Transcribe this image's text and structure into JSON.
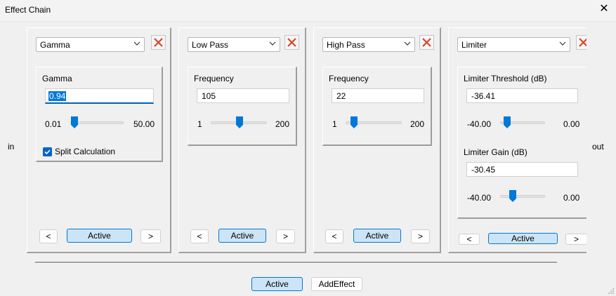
{
  "window": {
    "title": "Effect Chain"
  },
  "chain": {
    "in_label": "in",
    "out_label": "out"
  },
  "effects": [
    {
      "selected": "Gamma",
      "params": [
        {
          "label": "Gamma",
          "value": "0.94",
          "min": "0.01",
          "max": "50.00",
          "level": 0.02
        }
      ],
      "checkbox": {
        "label": "Split Calculation",
        "checked": true
      },
      "prev_label": "<",
      "active_label": "Active",
      "next_label": ">"
    },
    {
      "selected": "Low Pass",
      "params": [
        {
          "label": "Frequency",
          "value": "105",
          "min": "1",
          "max": "200",
          "level": 0.52
        }
      ],
      "prev_label": "<",
      "active_label": "Active",
      "next_label": ">"
    },
    {
      "selected": "High Pass",
      "params": [
        {
          "label": "Frequency",
          "value": "22",
          "min": "1",
          "max": "200",
          "level": 0.1
        }
      ],
      "prev_label": "<",
      "active_label": "Active",
      "next_label": ">"
    },
    {
      "selected": "Limiter",
      "params": [
        {
          "label": "Limiter Threshold (dB)",
          "value": "-36.41",
          "min": "-40.00",
          "max": "0.00",
          "level": 0.09
        },
        {
          "label": "Limiter Gain (dB)",
          "value": "-30.45",
          "min": "-40.00",
          "max": "0.00",
          "level": 0.24
        }
      ],
      "prev_label": "<",
      "active_label": "Active",
      "next_label": ">"
    }
  ],
  "footer": {
    "active_label": "Active",
    "add_effect_label": "AddEffect"
  },
  "colors": {
    "accent": "#0078d7",
    "close_x": "#d9442a",
    "active_fill": "#cce4f7"
  }
}
